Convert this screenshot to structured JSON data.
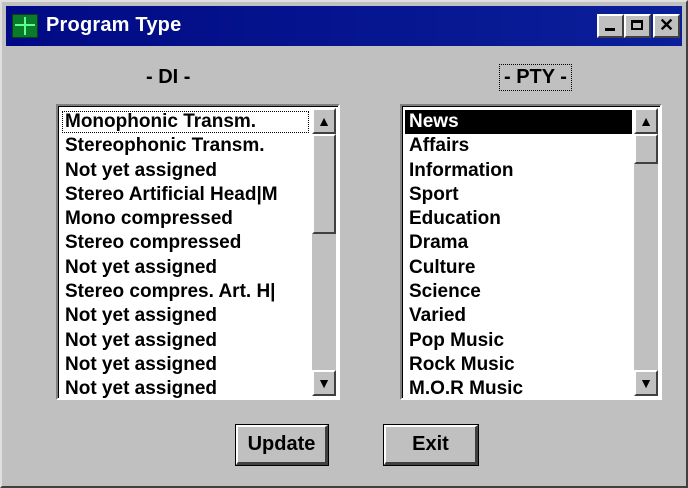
{
  "window": {
    "title": "Program Type",
    "controls": {
      "minimize": "minimize",
      "maximize": "maximize",
      "close": "✕"
    }
  },
  "di": {
    "label": "- DI -",
    "items": [
      "Monophonic Transm.",
      "Stereophonic Transm.",
      "Not yet assigned",
      "Stereo Artificial Head|M",
      "Mono compressed",
      "Stereo compressed",
      "Not yet assigned",
      "Stereo compres. Art. H|",
      "Not yet assigned",
      "Not yet assigned",
      "Not yet assigned",
      "Not yet assigned"
    ]
  },
  "pty": {
    "label": "- PTY -",
    "items": [
      "News",
      "Affairs",
      "Information",
      "Sport",
      "Education",
      "Drama",
      "Culture",
      "Science",
      "Varied",
      "Pop Music",
      "Rock Music",
      "M.O.R Music"
    ],
    "selected": "News"
  },
  "scroll": {
    "up_arrow": "▲",
    "down_arrow": "▼"
  },
  "buttons": {
    "update": "Update",
    "exit": "Exit"
  }
}
